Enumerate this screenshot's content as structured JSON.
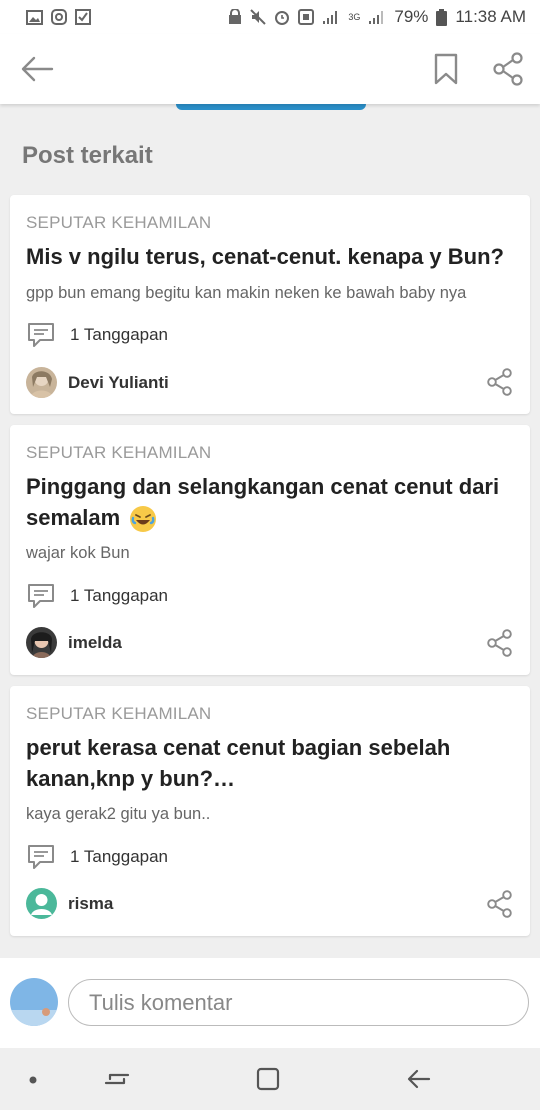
{
  "status_bar": {
    "battery": "79%",
    "time": "11:38 AM",
    "network": "3G"
  },
  "app_bar": {
    "back_icon": "back-arrow-icon",
    "bookmark_icon": "bookmark-icon",
    "share_icon": "share-icon"
  },
  "section": {
    "title": "Post terkait"
  },
  "posts": [
    {
      "category": "SEPUTAR KEHAMILAN",
      "title": "Mis v ngilu terus, cenat-cenut. kenapa y Bun?",
      "snippet": "gpp bun emang begitu kan makin neken ke bawah baby nya",
      "responses": "1 Tanggapan",
      "author": "Devi Yulianti"
    },
    {
      "category": "SEPUTAR KEHAMILAN",
      "title": "Pinggang dan selangkangan cenat cenut dari semalam",
      "snippet": "wajar kok Bun",
      "responses": "1 Tanggapan",
      "author": "imelda"
    },
    {
      "category": "SEPUTAR KEHAMILAN",
      "title": "perut kerasa cenat cenut bagian sebelah kanan,knp y bun?…",
      "snippet": "kaya gerak2 gitu ya bun..",
      "responses": "1 Tanggapan",
      "author": "risma"
    }
  ],
  "comment": {
    "placeholder": "Tulis komentar"
  },
  "colors": {
    "accent": "#2a8fc9",
    "icon_gray": "#8a8a8a",
    "avatar_teal": "#4bb89a"
  }
}
